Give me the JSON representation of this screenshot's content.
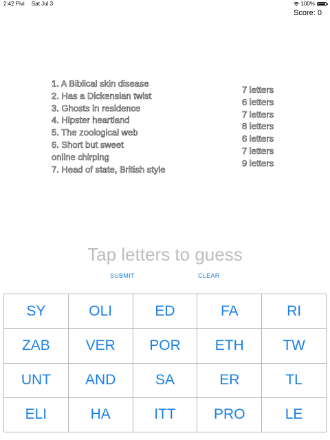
{
  "status_bar": {
    "time": "2:42 Pivi",
    "date": "Sat Jul 3",
    "battery": "100%",
    "icons": [
      "wifi-icon",
      "battery-icon"
    ]
  },
  "score_label": "Score: 0",
  "clues": [
    "1. A Biblical skin disease",
    "2. Has a Dickensian twist",
    "3. Ghosts in residence",
    "4. Hipster heartland",
    "5. The zoological web",
    "6. Short but sweet",
    "online chirping",
    "7. Head of state, British style"
  ],
  "lengths": [
    "7 letters",
    "6 letters",
    "7 letters",
    "8 letters",
    "6 letters",
    "7 letters",
    "9 letters"
  ],
  "guess_placeholder": "Tap letters to guess",
  "submit_label": "SUBMIT",
  "clear_label": "CLEAR",
  "tiles": [
    "SY",
    "OLI",
    "ED",
    "FA",
    "RI",
    "ZAB",
    "VER",
    "POR",
    "ETH",
    "TW",
    "UNT",
    "AND",
    "SA",
    "ER",
    "TL",
    "ELI",
    "HA",
    "ITT",
    "PRO",
    "LE"
  ],
  "colors": {
    "accent": "#1a7fe6",
    "placeholder": "#bdbdbd",
    "grid_line": "#b5b5b5"
  }
}
